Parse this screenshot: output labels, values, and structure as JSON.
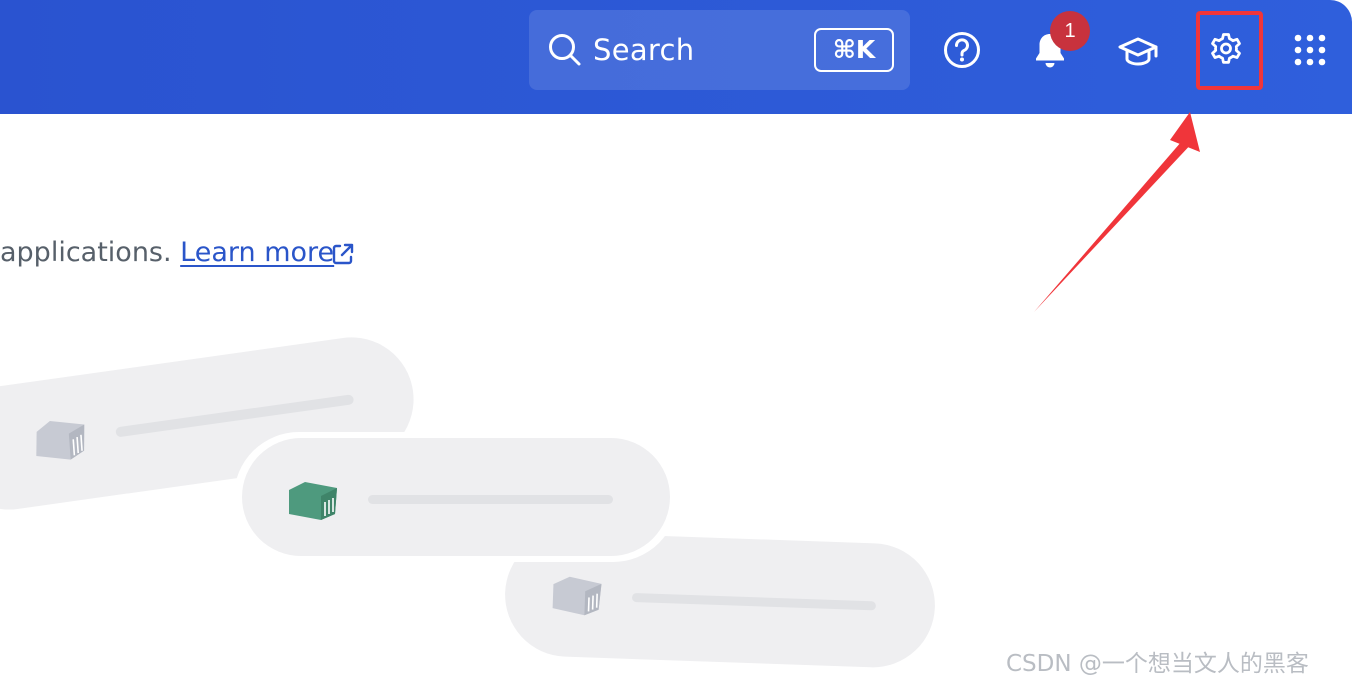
{
  "header": {
    "search": {
      "label": "Search",
      "shortcut": "⌘K",
      "icon": "search-icon"
    },
    "help": {
      "icon": "question-circle-icon"
    },
    "notifications": {
      "icon": "bell-icon",
      "count": "1"
    },
    "learning": {
      "icon": "graduation-cap-icon"
    },
    "settings": {
      "icon": "gear-icon",
      "highlighted": true
    },
    "apps": {
      "icon": "grid-icon"
    }
  },
  "main": {
    "description_partial": "applications. ",
    "learn_more": "Learn more",
    "learn_more_icon": "external-link-icon"
  },
  "annotation": {
    "color": "#f0353a"
  },
  "watermark": "CSDN @一个想当文人的黑客",
  "colors": {
    "header_bg": "#2a53d0",
    "link": "#2a55c9",
    "badge": "#c8323d",
    "container_active": "#4e9a7e",
    "container_inactive": "#c7cad3"
  }
}
